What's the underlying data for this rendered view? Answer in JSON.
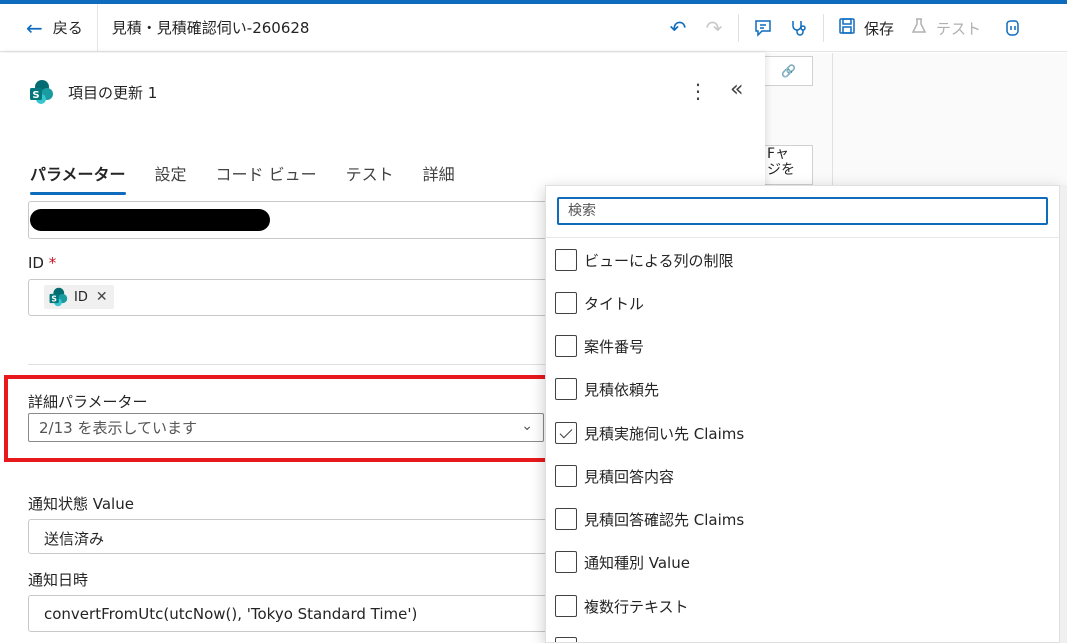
{
  "header": {
    "back_label": "戻る",
    "flow_title": "見積・見積確認伺い-260628",
    "save_label": "保存",
    "test_label": "テスト"
  },
  "panel": {
    "title": "項目の更新 1",
    "tabs": [
      {
        "label": "パラメーター",
        "active": true
      },
      {
        "label": "設定",
        "active": false
      },
      {
        "label": "コード ビュー",
        "active": false
      },
      {
        "label": "テスト",
        "active": false
      },
      {
        "label": "詳細",
        "active": false
      }
    ],
    "id_label": "ID",
    "id_required": "*",
    "id_token_label": "ID",
    "advanced_label": "詳細パラメーター",
    "advanced_value": "2/13 を表示しています",
    "notify_status_label": "通知状態 Value",
    "notify_status_value": "送信済み",
    "notify_datetime_label": "通知日時",
    "notify_datetime_value": "convertFromUtc(utcNow(), 'Tokyo Standard Time')"
  },
  "canvas": {
    "card2_text": "Fャ\nジを"
  },
  "dropdown": {
    "search_placeholder": "検索",
    "items": [
      {
        "label": "ビューによる列の制限",
        "checked": false
      },
      {
        "label": "タイトル",
        "checked": false
      },
      {
        "label": "案件番号",
        "checked": false
      },
      {
        "label": "見積依頼先",
        "checked": false
      },
      {
        "label": "見積実施伺い先 Claims",
        "checked": true
      },
      {
        "label": "見積回答内容",
        "checked": false
      },
      {
        "label": "見積回答確認先 Claims",
        "checked": false
      },
      {
        "label": "通知種別 Value",
        "checked": false
      },
      {
        "label": "複数行テキスト",
        "checked": false
      }
    ]
  },
  "colors": {
    "accent": "#0f6cbd",
    "highlight": "#e8191c"
  }
}
